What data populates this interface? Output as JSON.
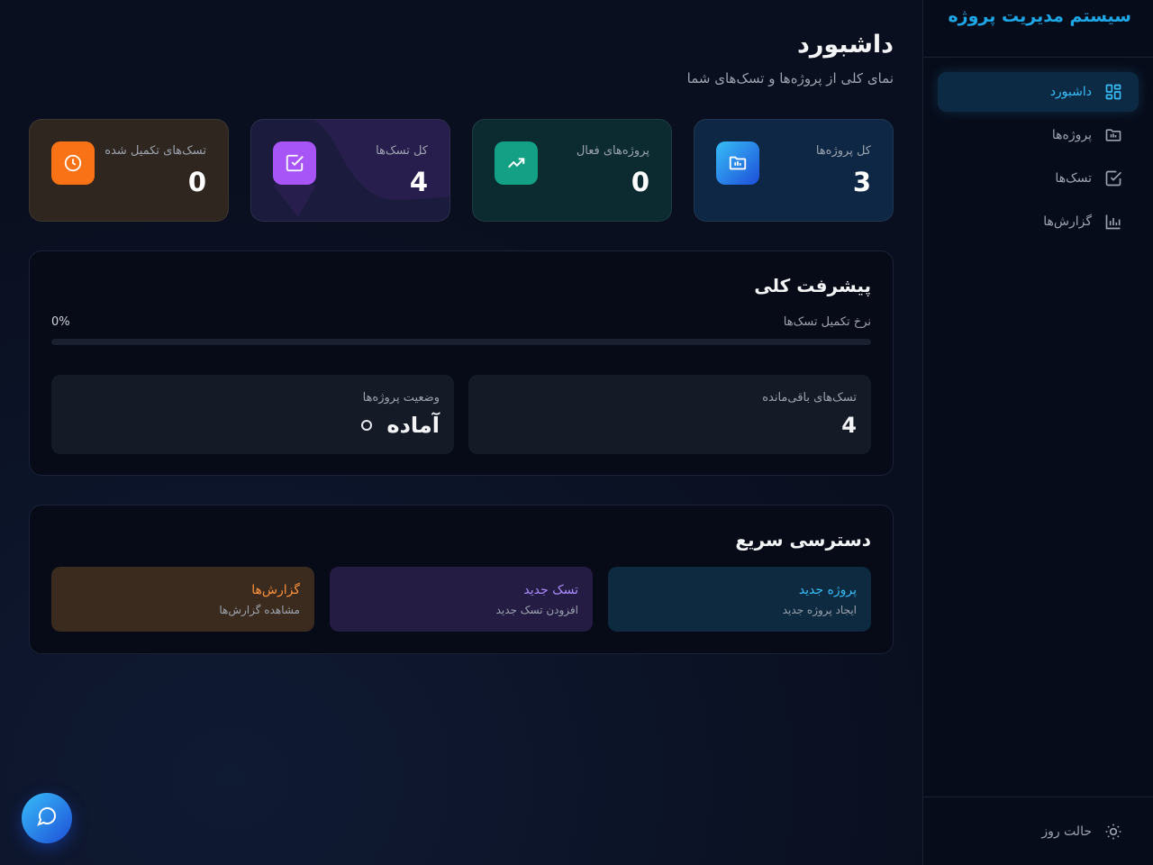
{
  "sidebar": {
    "brand": "سیستم مدیریت پروژه",
    "items": [
      {
        "label": "داشبورد",
        "icon": "dashboard-icon",
        "active": true
      },
      {
        "label": "پروژه‌ها",
        "icon": "folder-icon",
        "active": false
      },
      {
        "label": "تسک‌ها",
        "icon": "checkbox-icon",
        "active": false
      },
      {
        "label": "گزارش‌ها",
        "icon": "bar-chart-icon",
        "active": false
      }
    ],
    "theme_toggle": "حالت روز"
  },
  "header": {
    "title": "داشبورد",
    "subtitle": "نمای کلی از پروژه‌ها و تسک‌های شما"
  },
  "stats": [
    {
      "label": "کل پروژه‌ها",
      "value": "3",
      "icon": "folder-icon",
      "color": "#1ea7e6"
    },
    {
      "label": "پروژه‌های فعال",
      "value": "0",
      "icon": "trending-up-icon",
      "color": "#14a085"
    },
    {
      "label": "کل تسک‌ها",
      "value": "4",
      "icon": "checkbox-icon",
      "color": "#a855f7"
    },
    {
      "label": "تسک‌های تکمیل شده",
      "value": "0",
      "icon": "clock-icon",
      "color": "#f97316"
    }
  ],
  "progress": {
    "title": "پیشرفت کلی",
    "rate_label": "نرخ تکمیل تسک‌ها",
    "rate_value": "0%",
    "rate_fraction": 0,
    "remaining_label": "تسک‌های باقی‌مانده",
    "remaining_value": "4",
    "status_label": "وضعیت پروژه‌ها",
    "status_value": "آماده"
  },
  "quick_access": {
    "title": "دسترسی سریع",
    "items": [
      {
        "title": "پروژه جدید",
        "subtitle": "ایجاد پروژه جدید",
        "color": "#38bdf8"
      },
      {
        "title": "تسک جدید",
        "subtitle": "افزودن تسک جدید",
        "color": "#a78bfa"
      },
      {
        "title": "گزارش‌ها",
        "subtitle": "مشاهده گزارش‌ها",
        "color": "#fb923c"
      }
    ]
  },
  "chat_button": {
    "icon": "chat-icon"
  }
}
